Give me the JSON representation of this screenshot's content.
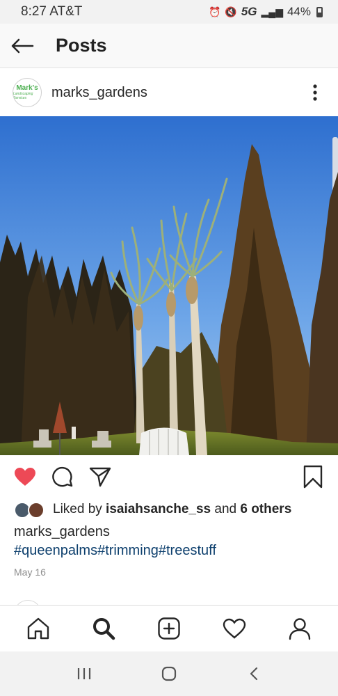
{
  "status_bar": {
    "time": "8:27 AT&T",
    "network": "5G",
    "battery": "44%"
  },
  "header": {
    "title": "Posts",
    "back_icon": "arrow-left-icon"
  },
  "post": {
    "username": "marks_gardens",
    "avatar_logo_text": "Mark's",
    "avatar_logo_sub": "Landscaping Services",
    "more_icon": "more-vertical-icon",
    "liked": true,
    "likes_prefix": "Liked by ",
    "liked_by_user": "isaiahsanche_ss",
    "likes_middle": " and ",
    "likes_others": "6 others",
    "caption_username": "marks_gardens",
    "hashtags": "#queenpalms#trimming#treestuff",
    "date": "May 16"
  },
  "actions": {
    "like_icon": "heart-filled-icon",
    "comment_icon": "comment-icon",
    "share_icon": "send-icon",
    "save_icon": "bookmark-icon"
  },
  "bottom_nav": {
    "items": [
      "home-icon",
      "search-icon",
      "add-post-icon",
      "activity-heart-icon",
      "profile-icon"
    ],
    "active": "search-icon"
  },
  "system_nav": {
    "items": [
      "recent-apps-icon",
      "home-button-icon",
      "back-chevron-icon"
    ]
  },
  "colors": {
    "like_red": "#ed4956",
    "hashtag_blue": "#0d3f6d",
    "logo_green": "#4caf50",
    "sky_blue": "#3a7bd5"
  }
}
